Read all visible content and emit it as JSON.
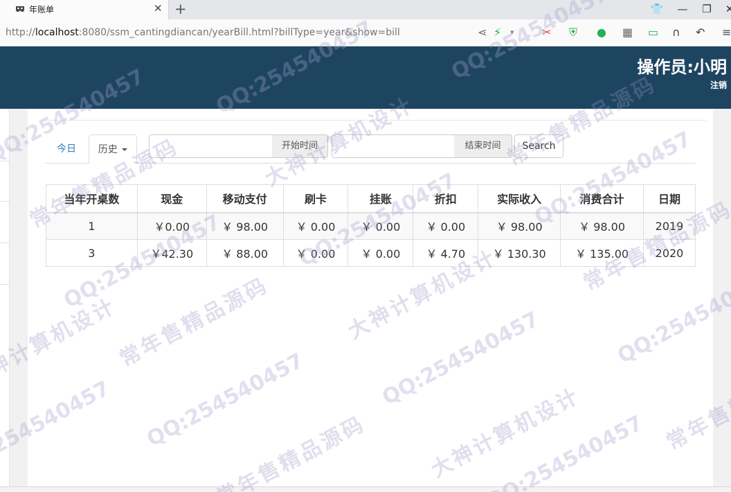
{
  "browser": {
    "tab_title": "年账单",
    "url_prefix": "http://",
    "url_host": "localhost",
    "url_rest": ":8080/ssm_cantingdiancan/yearBill.html?billType=year&show=bill"
  },
  "header": {
    "operator": "操作员:小明",
    "logout": "注销",
    "bg_color": "#1e4560"
  },
  "tabs": {
    "today": "今日",
    "history": "历史"
  },
  "filters": {
    "start_label": "开始时间",
    "end_label": "结束时间",
    "start_value": "",
    "end_value": "",
    "search_label": "Search"
  },
  "table": {
    "headers": [
      "当年开桌数",
      "现金",
      "移动支付",
      "刷卡",
      "挂账",
      "折扣",
      "实际收入",
      "消费合计",
      "日期"
    ],
    "rows": [
      [
        "1",
        "￥0.00",
        "￥ 98.00",
        "￥ 0.00",
        "￥ 0.00",
        "￥ 0.00",
        "￥ 98.00",
        "￥ 98.00",
        "2019"
      ],
      [
        "3",
        "￥42.30",
        "￥ 88.00",
        "￥ 0.00",
        "￥ 0.00",
        "￥ 4.70",
        "￥ 130.30",
        "￥ 135.00",
        "2020"
      ]
    ]
  },
  "watermarks": {
    "qq": "QQ:254540457",
    "a": "大神计算机设计",
    "b": "常年售精品源码"
  }
}
